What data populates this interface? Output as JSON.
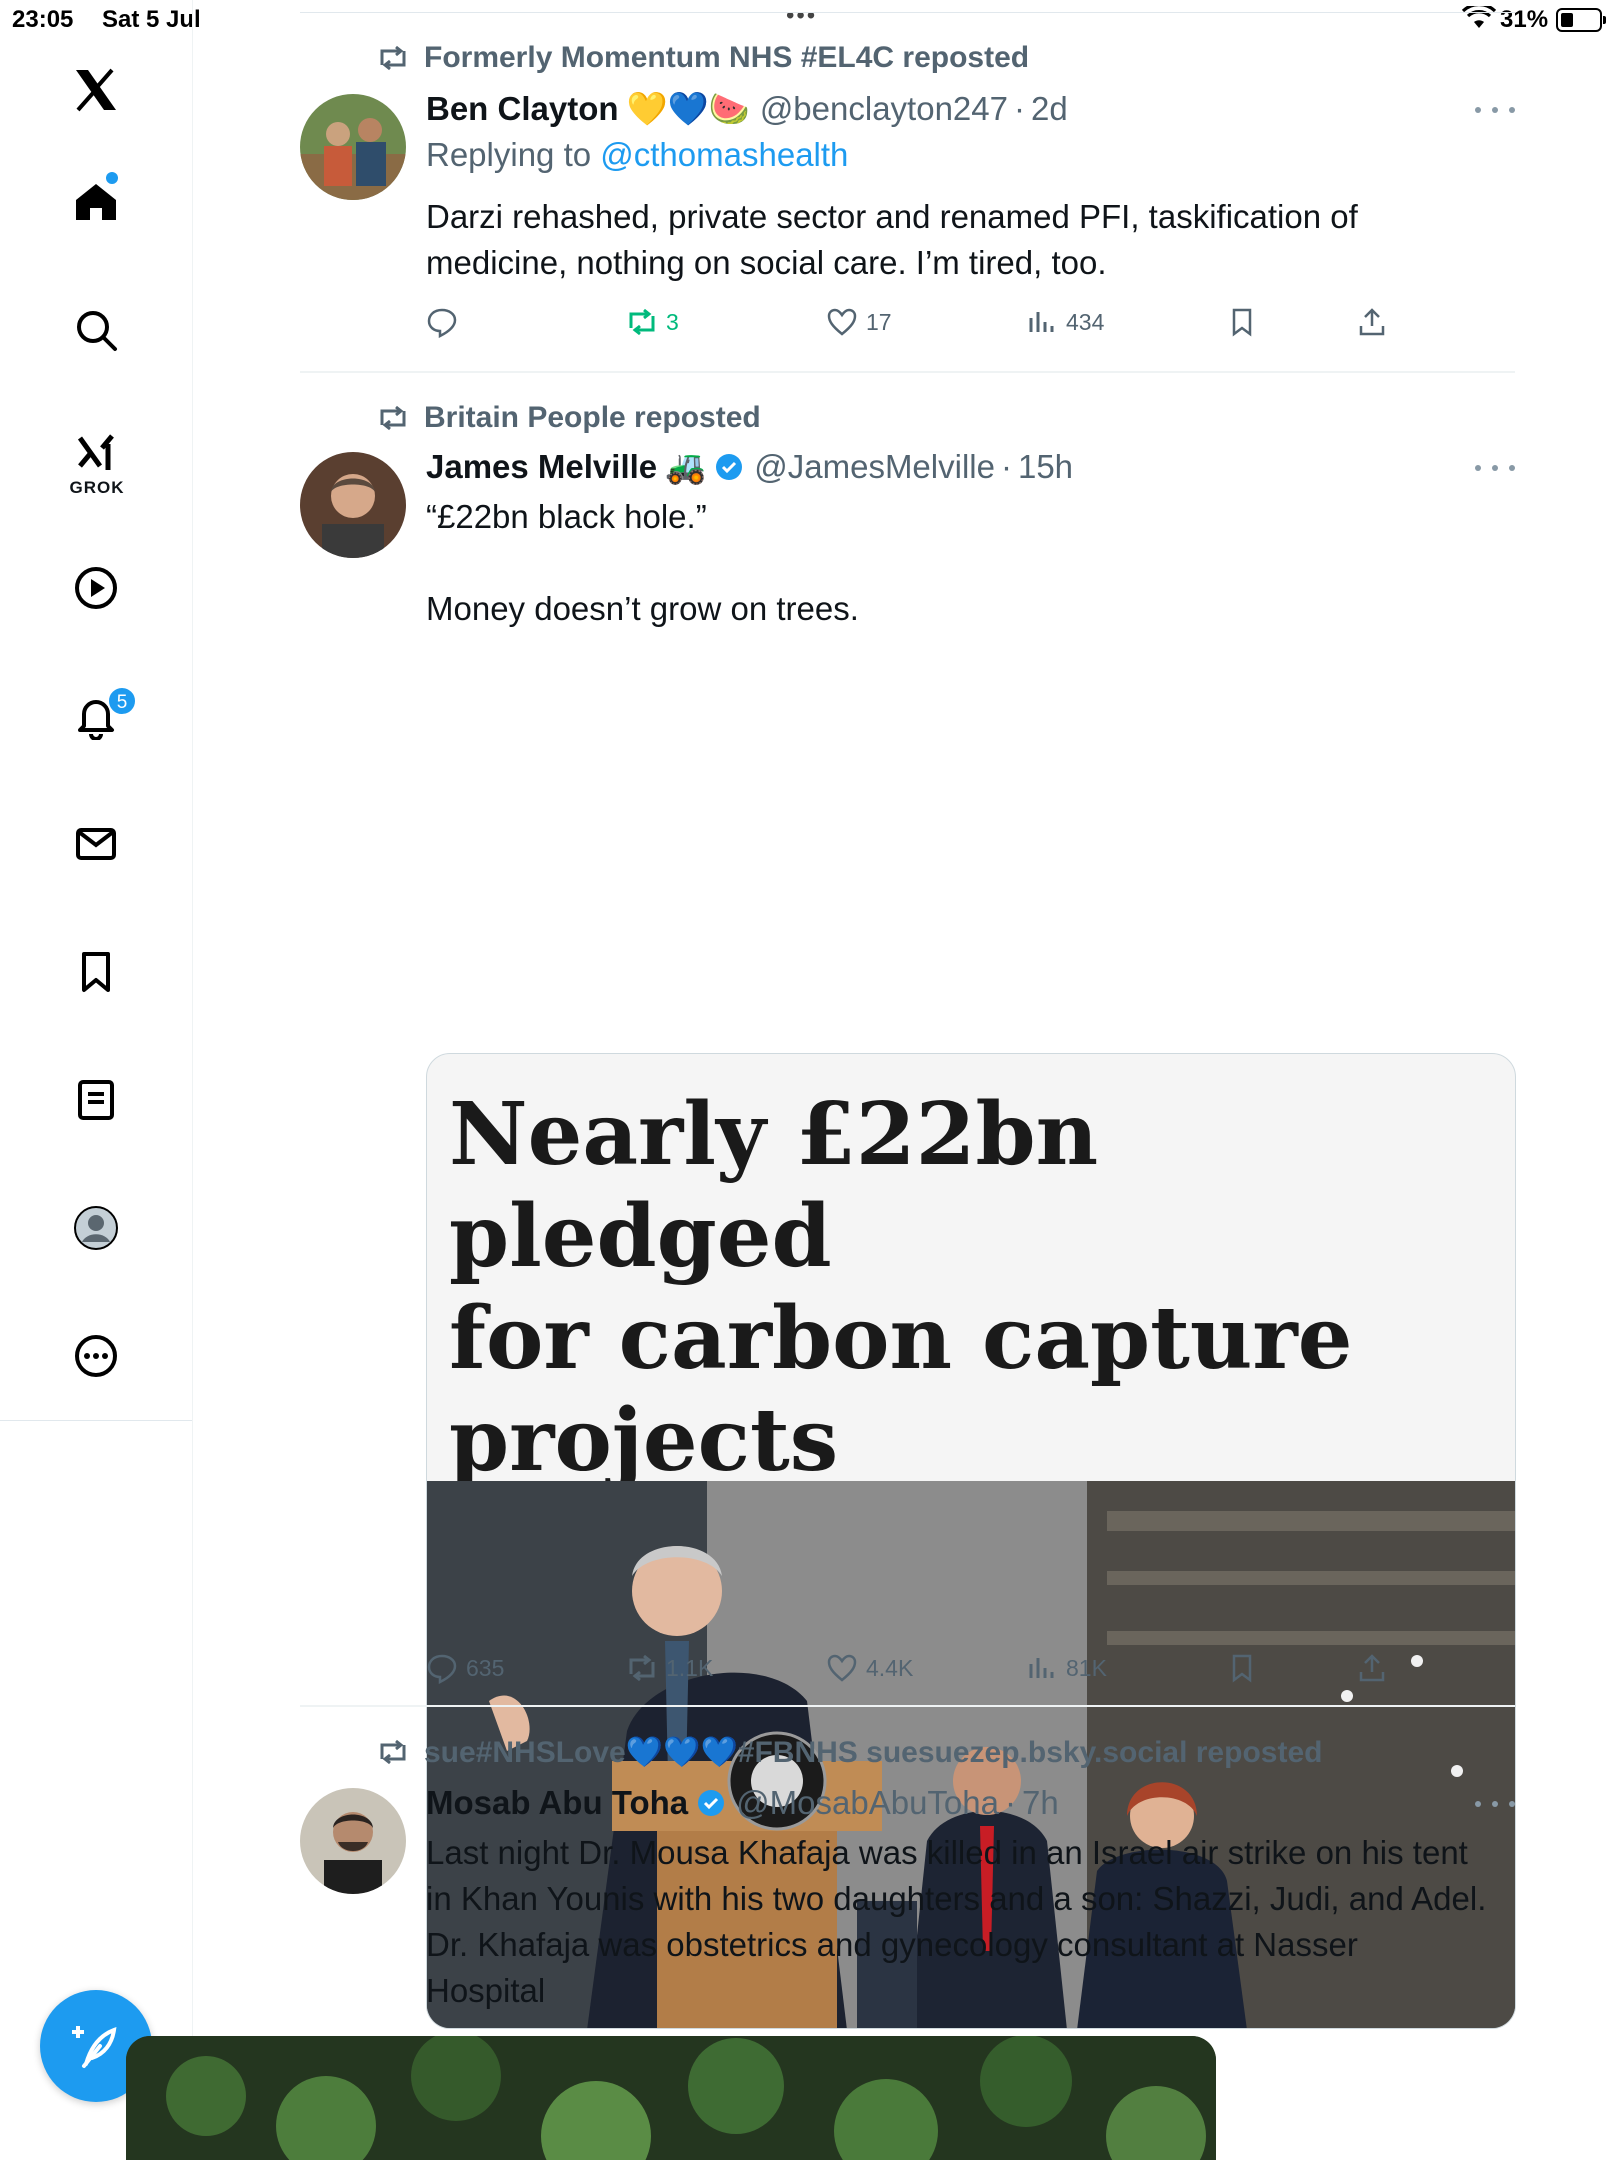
{
  "status_bar": {
    "time": "23:05",
    "date": "Sat 5 Jul",
    "battery_pct": "31%"
  },
  "sidebar": {
    "items": [
      {
        "name": "x-logo"
      },
      {
        "name": "home"
      },
      {
        "name": "search"
      },
      {
        "name": "grok",
        "label": "GROK"
      },
      {
        "name": "video"
      },
      {
        "name": "notifications",
        "badge": "5"
      },
      {
        "name": "messages"
      },
      {
        "name": "bookmarks"
      },
      {
        "name": "lists"
      },
      {
        "name": "profile"
      },
      {
        "name": "more"
      }
    ]
  },
  "tweets": [
    {
      "repost_by": "Formerly Momentum NHS #EL4C reposted",
      "author": "Ben Clayton",
      "emoji": "💛💙🍉",
      "handle": "@benclayton247",
      "sep": "·",
      "time": "2d",
      "replying_prefix": "Replying to ",
      "replying_to": "@cthomashealth",
      "text_lines": [
        "Darzi rehashed, private sector and renamed PFI, taskification of",
        "medicine, nothing on social care. I’m tired, too."
      ],
      "replies": "",
      "reposts": "3",
      "likes": "17",
      "views": "434"
    },
    {
      "repost_by": "Britain People reposted",
      "author": "James Melville",
      "emoji": "🚜",
      "handle": "@JamesMelville",
      "sep": "·",
      "time": "15h",
      "text_lines": [
        "“£22bn black hole.”",
        "",
        "Money doesn’t grow on trees."
      ],
      "card_headline_lines": [
        "Nearly £22bn pledged",
        "for carbon capture",
        "projects"
      ],
      "replies": "635",
      "reposts": "1.1K",
      "likes": "4.4K",
      "views": "81K"
    },
    {
      "repost_by": "sue#NHSLove💙💙💙#FBNHS suesuezep.bsky.social reposted",
      "author": "Mosab Abu Toha",
      "handle": "@MosabAbuToha",
      "sep": "·",
      "time": "7h",
      "text_lines": [
        "Last night Dr. Mousa Khafaja was killed in an Israel air strike on his tent",
        "in Khan Younis with his two daughters and a son: Shazzi, Judi, and Adel.",
        "Dr. Khafaja was obstetrics and gynecology consultant at Nasser",
        "Hospital"
      ]
    }
  ],
  "colors": {
    "accent": "#1d9bf0",
    "secondary_text": "#536471",
    "repost_green": "#00ba7c"
  }
}
